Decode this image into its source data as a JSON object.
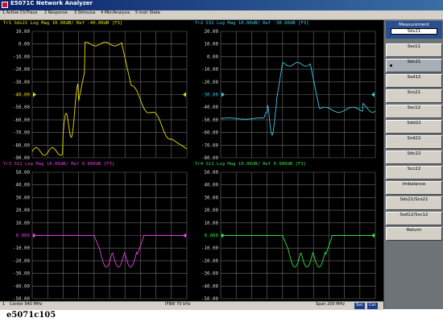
{
  "window": {
    "title": "E5071C Network Analyzer",
    "icon": "app-icon"
  },
  "menu": [
    {
      "label": "1 Active Ch/Trace"
    },
    {
      "label": "2 Response"
    },
    {
      "label": "3 Stimulus"
    },
    {
      "label": "4 Mkr/Analysis"
    },
    {
      "label": "5 Instr State"
    }
  ],
  "colors": {
    "tr1": "#e8e000",
    "tr2": "#3cc8e6",
    "tr3": "#e040e0",
    "tr4": "#30e040",
    "grid": "#6e6e6e",
    "titlebar": "#0a246a",
    "softkey_title": "#2a4f8e"
  },
  "charts": [
    {
      "label": "Tr1",
      "header": "Tr1 Sds21 Log Mag 10.00dB/ Ref -40.00dB [F3]",
      "color": "#e8e000",
      "y_labels": [
        "10.00",
        "0.00",
        "-10.00",
        "-20.00",
        "-30.00",
        "-40.00",
        "-50.00",
        "-60.00",
        "-70.00",
        "-80.00",
        "-90.00"
      ],
      "ref_level": "-40.00"
    },
    {
      "label": "Tr2",
      "header": "Tr2 S31 Log Mag 10.00dB/ Ref -30.00dB [F3]",
      "color": "#3cc8e6",
      "y_labels": [
        "20.00",
        "10.00",
        "0.00",
        "-10.00",
        "-20.00",
        "-30.00",
        "-40.00",
        "-50.00",
        "-60.00",
        "-70.00",
        "-80.00"
      ],
      "ref_level": "-30.00"
    },
    {
      "label": "Tr3",
      "header": "Tr3 S11 Log Mag 10.00dB/ Ref 0.000dB [F3]",
      "color": "#e040e0",
      "y_labels": [
        "50.00",
        "40.00",
        "30.00",
        "20.00",
        "10.00",
        "0.000",
        "-10.00",
        "-20.00",
        "-30.00",
        "-40.00",
        "-50.00"
      ],
      "ref_level": "0.000"
    },
    {
      "label": "Tr4",
      "header": "Tr4 S11 Log Mag 10.00dB/ Ref 0.000dB [F3]",
      "color": "#30e040",
      "y_labels": [
        "50.00",
        "40.00",
        "30.00",
        "20.00",
        "10.00",
        "0.000",
        "-10.00",
        "-20.00",
        "-30.00",
        "-40.00",
        "-50.00"
      ],
      "ref_level": "0.000"
    }
  ],
  "status": {
    "channel": "1",
    "center": "Center 940 MHz",
    "ifbw": "IFBW 70 kHz",
    "span": "Span 200 MHz",
    "badge1": "Svc",
    "badge2": "Cor"
  },
  "softkeys": {
    "title": "Measurement",
    "current": "Sds21",
    "items": [
      {
        "label": "Sss11",
        "selected": false
      },
      {
        "label": "Sds21",
        "selected": true
      },
      {
        "label": "Ssd12",
        "selected": false
      },
      {
        "label": "Scs21",
        "selected": false
      },
      {
        "label": "Ssc12",
        "selected": false
      },
      {
        "label": "Sdd22",
        "selected": false
      },
      {
        "label": "Scd22",
        "selected": false
      },
      {
        "label": "Sdc22",
        "selected": false
      },
      {
        "label": "Scc22",
        "selected": false
      },
      {
        "label": "Imbalance",
        "selected": false
      },
      {
        "label": "Sds21/Scs21",
        "selected": false
      },
      {
        "label": "Ssd12/Ssc12",
        "selected": false
      },
      {
        "label": "Return",
        "selected": false
      }
    ]
  },
  "caption": "e5071c105"
}
